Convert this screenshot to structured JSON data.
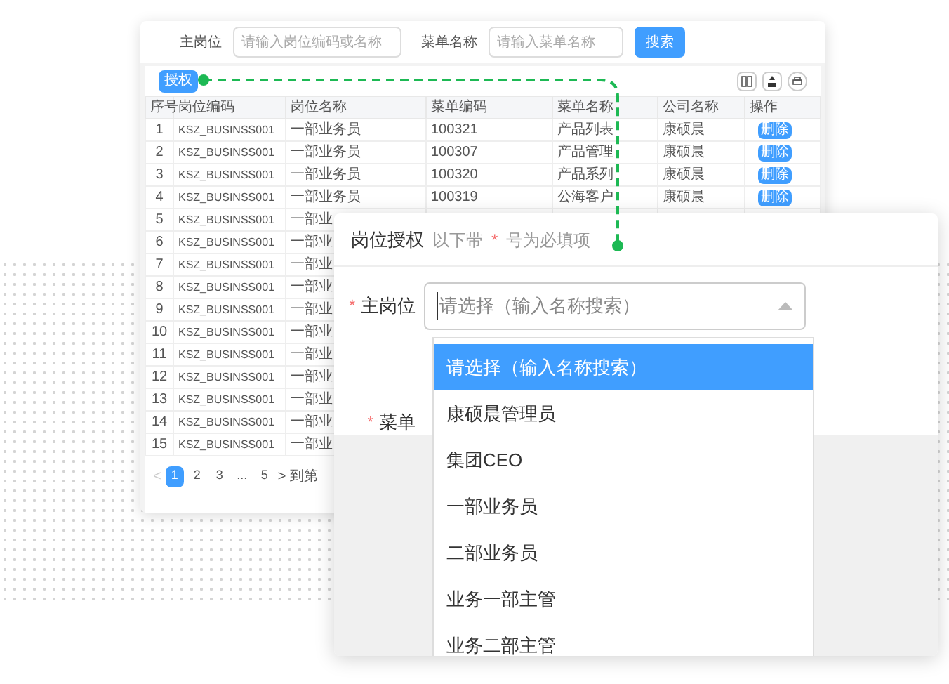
{
  "search_form": {
    "fields": [
      {
        "label": "主岗位",
        "placeholder": "请输入岗位编码或名称"
      },
      {
        "label": "菜单名称",
        "placeholder": "请输入菜单名称"
      }
    ],
    "search_button": "搜索"
  },
  "toolbar": {
    "grant_button": "授权"
  },
  "table": {
    "columns": [
      "序号",
      "岗位编码",
      "岗位名称",
      "菜单编码",
      "菜单名称",
      "公司名称",
      "操作"
    ],
    "rows": [
      {
        "cells": [
          "1",
          "KSZ_BUSINSS001",
          "一部业务员",
          "100321",
          "产品列表",
          "康硕晨"
        ],
        "action": "删除"
      },
      {
        "cells": [
          "2",
          "KSZ_BUSINSS001",
          "一部业务员",
          "100307",
          "产品管理",
          "康硕晨"
        ],
        "action": "删除"
      },
      {
        "cells": [
          "3",
          "KSZ_BUSINSS001",
          "一部业务员",
          "100320",
          "产品系列",
          "康硕晨"
        ],
        "action": "删除"
      },
      {
        "cells": [
          "4",
          "KSZ_BUSINSS001",
          "一部业务员",
          "100319",
          "公海客户",
          "康硕晨"
        ],
        "action": "删除"
      },
      {
        "cells": [
          "5",
          "KSZ_BUSINSS001",
          "一部业"
        ]
      },
      {
        "cells": [
          "6",
          "KSZ_BUSINSS001",
          "一部业"
        ]
      },
      {
        "cells": [
          "7",
          "KSZ_BUSINSS001",
          "一部业"
        ]
      },
      {
        "cells": [
          "8",
          "KSZ_BUSINSS001",
          "一部业"
        ]
      },
      {
        "cells": [
          "9",
          "KSZ_BUSINSS001",
          "一部业"
        ]
      },
      {
        "cells": [
          "10",
          "KSZ_BUSINSS001",
          "一部业"
        ]
      },
      {
        "cells": [
          "11",
          "KSZ_BUSINSS001",
          "一部业"
        ]
      },
      {
        "cells": [
          "12",
          "KSZ_BUSINSS001",
          "一部业"
        ]
      },
      {
        "cells": [
          "13",
          "KSZ_BUSINSS001",
          "一部业"
        ]
      },
      {
        "cells": [
          "14",
          "KSZ_BUSINSS001",
          "一部业"
        ]
      },
      {
        "cells": [
          "15",
          "KSZ_BUSINSS001",
          "一部业"
        ]
      }
    ]
  },
  "pagination": {
    "previous": "<",
    "next": ">",
    "pages": [
      {
        "label": "1",
        "selected": true
      },
      {
        "label": "2",
        "selected": false
      },
      {
        "label": "3",
        "selected": false
      },
      {
        "label": "...",
        "selected": false
      },
      {
        "label": "5",
        "selected": false
      }
    ],
    "goto_label": "到第"
  },
  "dialog": {
    "title": "岗位授权",
    "hint_before": "以下带",
    "required_mark": "*",
    "hint_after": "号为必填项",
    "fields": [
      {
        "label": "主岗位",
        "required": true,
        "placeholder": "请选择（输入名称搜索）",
        "expanded": true
      },
      {
        "label": "菜单",
        "required": true
      }
    ],
    "options": [
      {
        "label": "请选择（输入名称搜索）",
        "selected": true
      },
      {
        "label": "康硕晨管理员",
        "selected": false
      },
      {
        "label": "集团CEO",
        "selected": false
      },
      {
        "label": "一部业务员",
        "selected": false
      },
      {
        "label": "二部业务员",
        "selected": false
      },
      {
        "label": "业务一部主管",
        "selected": false
      },
      {
        "label": "业务二部主管",
        "selected": false
      }
    ]
  }
}
